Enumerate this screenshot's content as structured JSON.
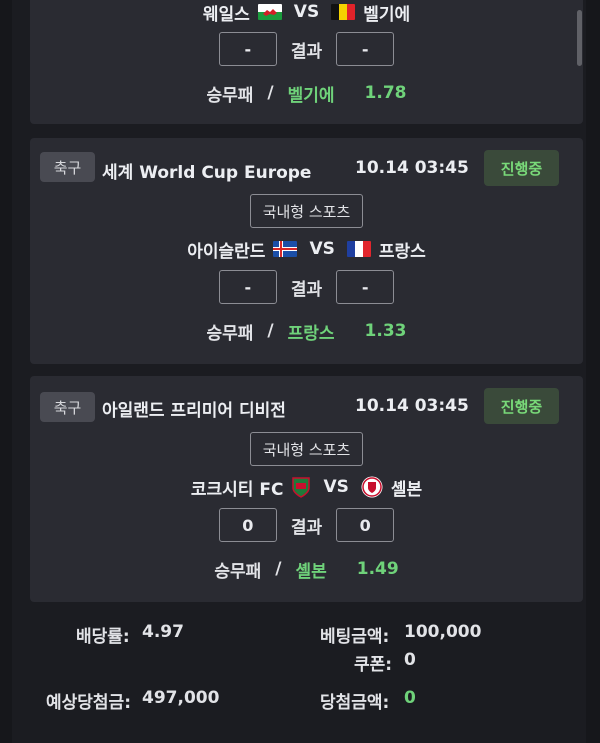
{
  "matches": [
    {
      "home": "웨일스",
      "home_flag": "wales-flag",
      "vs": "VS",
      "away": "벨기에",
      "away_flag": "belgium-flag",
      "score_home": "-",
      "score_away": "-",
      "result_label": "결과",
      "pick_label": "승무패",
      "slash": "/",
      "pick": "벨기에",
      "odds": "1.78"
    },
    {
      "sport": "축구",
      "league": "세계 World Cup Europe",
      "time": "10.14 03:45",
      "status": "진행중",
      "type": "국내형 스포츠",
      "home": "아이슬란드",
      "home_flag": "iceland-flag",
      "vs": "VS",
      "away": "프랑스",
      "away_flag": "france-flag",
      "score_home": "-",
      "score_away": "-",
      "result_label": "결과",
      "pick_label": "승무패",
      "slash": "/",
      "pick": "프랑스",
      "odds": "1.33"
    },
    {
      "sport": "축구",
      "league": "아일랜드 프리미어 디비전",
      "time": "10.14 03:45",
      "status": "진행중",
      "type": "국내형 스포츠",
      "home": "코크시티 FC",
      "home_flag": "cork-city-crest-icon",
      "vs": "VS",
      "away": "셸본",
      "away_flag": "shelbourne-crest-icon",
      "score_home": "0",
      "score_away": "0",
      "result_label": "결과",
      "pick_label": "승무패",
      "slash": "/",
      "pick": "셸본",
      "odds": "1.49"
    }
  ],
  "summary": {
    "odds_label": "배당률:",
    "odds_value": "4.97",
    "bet_label": "베팅금액:",
    "bet_value": "100,000",
    "coupon_label": "쿠폰:",
    "coupon_value": "0",
    "expected_label": "예상당첨금:",
    "expected_value": "497,000",
    "win_label": "당첨금액:",
    "win_value": "0"
  },
  "colors": {
    "accent_green": "#6fd27a",
    "status_bg": "#3a4a3a",
    "card_bg": "#2a2b32"
  }
}
